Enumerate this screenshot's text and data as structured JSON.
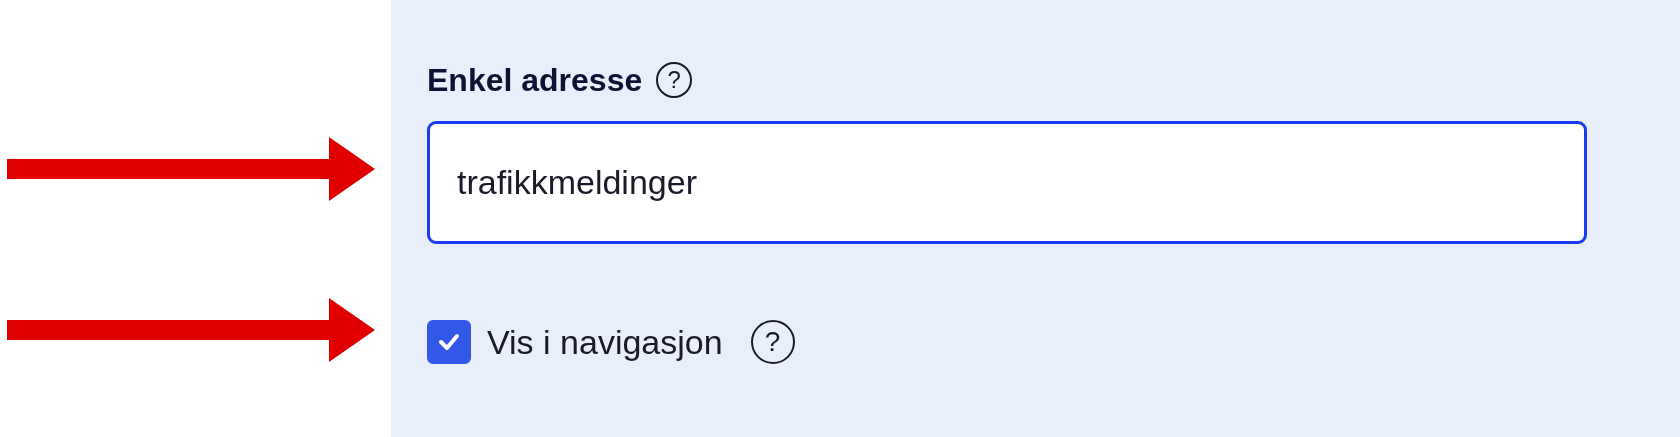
{
  "field": {
    "label": "Enkel adresse",
    "help": "?",
    "value": "trafikkmeldinger"
  },
  "checkbox": {
    "label": "Vis i navigasjon",
    "checked": true,
    "help": "?"
  }
}
